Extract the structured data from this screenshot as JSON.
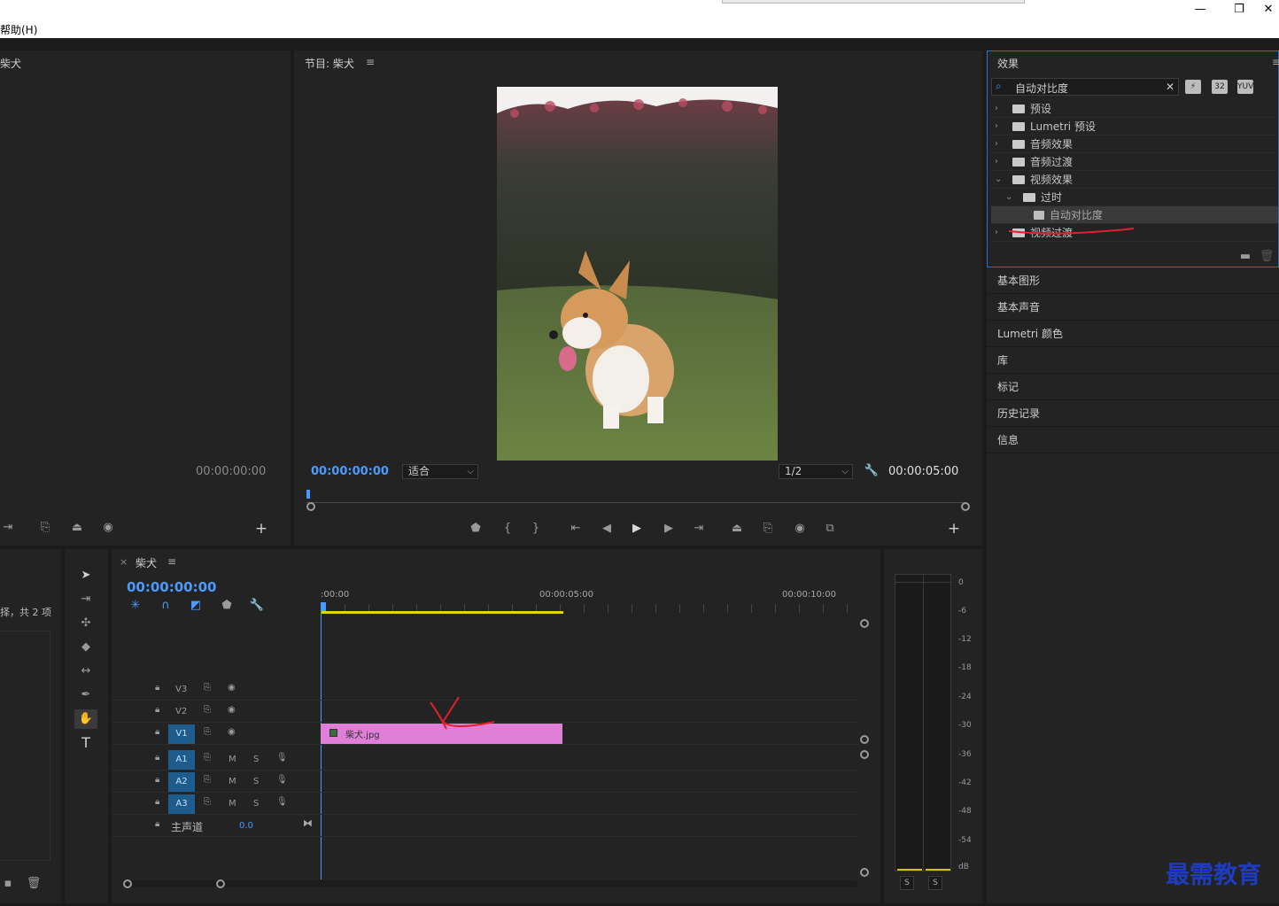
{
  "window": {
    "menu_fragment": "帮助(H)",
    "minimize": "—",
    "restore": "❐",
    "close": "✕"
  },
  "source": {
    "title_fragment": "柴犬",
    "timecode": "00:00:00:00",
    "add": "+"
  },
  "program": {
    "title": "节目: 柴犬",
    "menu": "≡",
    "timecode": "00:00:00:00",
    "fit_option": "适合",
    "resolution": "1/2",
    "duration": "00:00:05:00",
    "add": "+"
  },
  "effects": {
    "title": "效果",
    "menu": "≡",
    "search_value": "自动对比度",
    "tree": [
      {
        "label": "预设",
        "level": 0,
        "expanded": false,
        "type": "preset-folder"
      },
      {
        "label": "Lumetri 预设",
        "level": 0,
        "expanded": false,
        "type": "preset-folder"
      },
      {
        "label": "音频效果",
        "level": 0,
        "expanded": false,
        "type": "folder"
      },
      {
        "label": "音频过渡",
        "level": 0,
        "expanded": false,
        "type": "folder"
      },
      {
        "label": "视频效果",
        "level": 0,
        "expanded": true,
        "type": "folder"
      },
      {
        "label": "过时",
        "level": 1,
        "expanded": true,
        "type": "folder"
      },
      {
        "label": "自动对比度",
        "level": 2,
        "expanded": false,
        "type": "effect",
        "selected": true
      },
      {
        "label": "视频过渡",
        "level": 0,
        "expanded": false,
        "type": "folder"
      }
    ]
  },
  "right_stack": [
    "基本图形",
    "基本声音",
    "Lumetri 颜色",
    "库",
    "标记",
    "历史记录",
    "信息"
  ],
  "project": {
    "count_fragment": "择，共 2 项"
  },
  "timeline": {
    "tab_close": "×",
    "title": "柴犬",
    "menu": "≡",
    "timecode": "00:00:00:00",
    "ruler": [
      ":00:00",
      "00:00:05:00",
      "00:00:10:00"
    ],
    "video_tracks": [
      "V3",
      "V2",
      "V1"
    ],
    "audio_tracks": [
      "A1",
      "A2",
      "A3"
    ],
    "mute": "M",
    "solo": "S",
    "master_label": "主声道",
    "master_value": "0.0",
    "clip_name": "柴犬.jpg"
  },
  "meter": {
    "scale": [
      "0",
      "-6",
      "-12",
      "-18",
      "-24",
      "-30",
      "-36",
      "-42",
      "-48",
      "-54",
      "dB"
    ],
    "solo_left": "S",
    "solo_right": "S"
  },
  "watermark": "最需教育",
  "colors": {
    "accent": "#4a9bff",
    "clip": "#e07fd8",
    "track_selected": "#1d5c8c",
    "playbar": "#e6d400"
  }
}
